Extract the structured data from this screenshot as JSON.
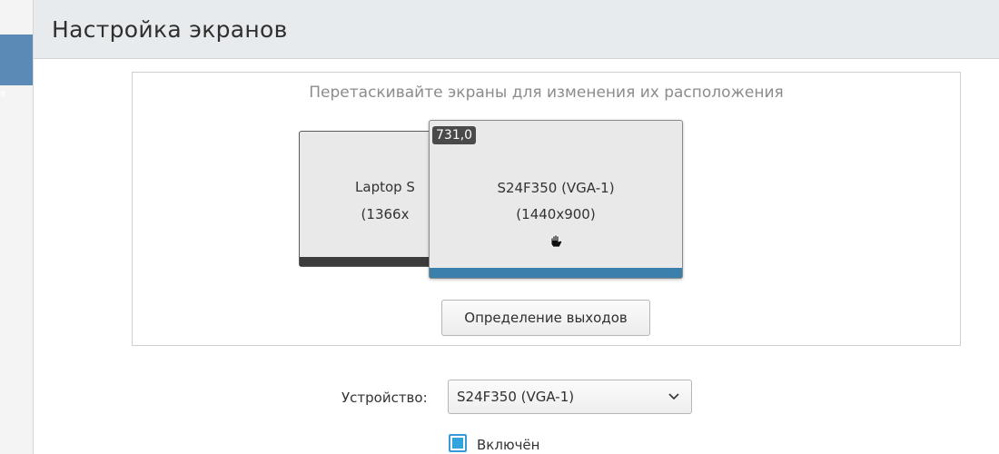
{
  "header": {
    "title": "Настройка экранов"
  },
  "sidebar": {
    "selected_fragment": "в"
  },
  "arrangement": {
    "hint": "Перетаскивайте экраны для изменения их расположения",
    "screens": [
      {
        "name_visible": "Laptop S",
        "resolution_visible": "(1366x"
      },
      {
        "name": "S24F350 (VGA-1)",
        "resolution": "(1440x900)",
        "position_label": "731,0"
      }
    ],
    "detect_button": "Определение выходов"
  },
  "device": {
    "label": "Устройство:",
    "selected": "S24F350 (VGA-1)"
  },
  "enabled": {
    "label": "Включён",
    "checked": true
  },
  "colors": {
    "accent": "#3b7fac",
    "checkbox": "#33a3dc",
    "header_bg": "#e7ebed"
  },
  "icons": {
    "cursor": "grab-hand-icon",
    "dropdown": "chevron-down-icon"
  }
}
